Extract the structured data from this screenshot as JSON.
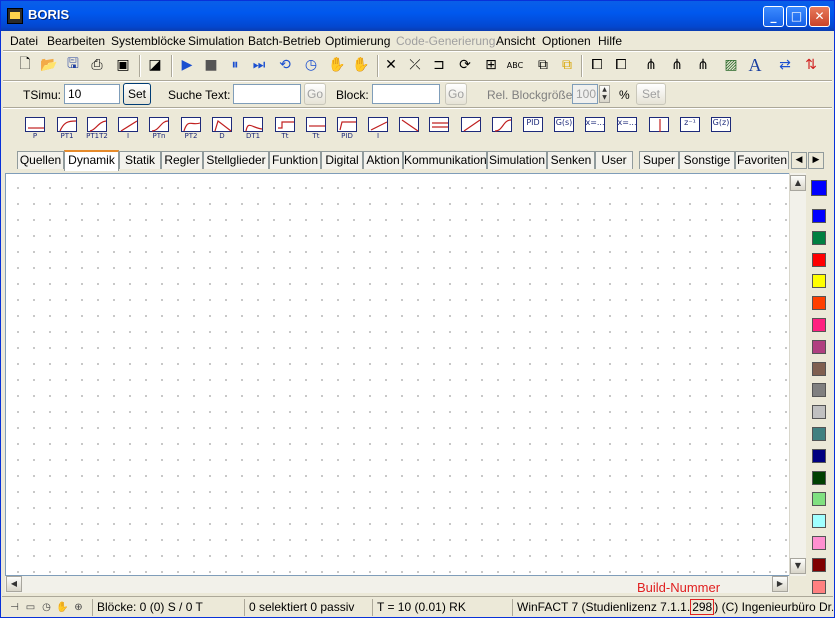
{
  "window": {
    "title": "BORIS",
    "minimize": "_",
    "maximize": "□",
    "close": "✕"
  },
  "menu": [
    "Datei",
    "Bearbeiten",
    "Systemblöcke",
    "Simulation",
    "Batch-Betrieb",
    "Optimierung",
    "Code-Generierung",
    "Ansicht",
    "Optionen",
    "Hilfe"
  ],
  "options": {
    "tsimu_label": "TSimu:",
    "tsimu_value": "10",
    "set_label": "Set",
    "search_label": "Suche  Text:",
    "search_value": "",
    "go_label": "Go",
    "block_label": "Block:",
    "block_value": "",
    "go2_label": "Go",
    "rel_label": "Rel. Blockgröße:",
    "rel_value": "100",
    "percent": "%",
    "set2_label": "Set"
  },
  "blocks": [
    "P",
    "PT1",
    "PT1T2",
    "I",
    "PTn",
    "PT2",
    "D",
    "DT1",
    "Tt",
    "Tt",
    "PID",
    "I",
    "",
    "",
    "",
    "",
    "PID",
    "G(s)",
    "x=...",
    "x=...",
    "",
    "z⁻¹",
    "G(z)"
  ],
  "tabs": [
    "Quellen",
    "Dynamik",
    "Statik",
    "Regler",
    "Stellglieder",
    "Funktion",
    "Digital",
    "Aktion",
    "Kommunikation",
    "Simulation",
    "Senken",
    "User",
    "Super",
    "Sonstige",
    "Favoriten"
  ],
  "active_tab": "Dynamik",
  "colors": [
    "#0000ff",
    "#0000ff",
    "#008040",
    "#ff0000",
    "#ffff00",
    "#ff4000",
    "#ff2080",
    "#b04080",
    "#806050",
    "#808080",
    "#c0c0c0",
    "#408080",
    "#000080",
    "#004000",
    "#80e080",
    "#a0ffff",
    "#ff90d0",
    "#800000",
    "#ff8080"
  ],
  "build_label": "Build-Nummer",
  "status": {
    "blocks": "Blöcke: 0 (0) S / 0 T",
    "selected": "0 selektiert  0 passiv",
    "time": "T = 10  (0.01)  RK",
    "version_prefix": "WinFACT 7 (Studienlizenz 7.1.1.",
    "build": "298",
    "version_suffix": ")",
    "copyright": "(C) Ingenieurbüro Dr. Ka"
  }
}
